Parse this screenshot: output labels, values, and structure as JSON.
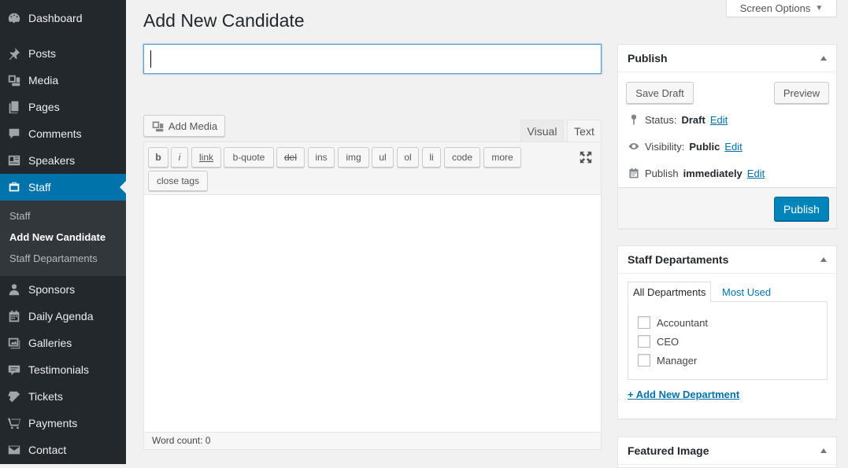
{
  "sidebar": {
    "items": [
      {
        "label": "Dashboard",
        "icon": "dashboard-icon"
      },
      {
        "label": "Posts",
        "icon": "pin-icon"
      },
      {
        "label": "Media",
        "icon": "media-icon"
      },
      {
        "label": "Pages",
        "icon": "pages-icon"
      },
      {
        "label": "Comments",
        "icon": "comment-icon"
      },
      {
        "label": "Speakers",
        "icon": "id-card-icon"
      },
      {
        "label": "Staff",
        "icon": "staff-icon"
      },
      {
        "label": "Sponsors",
        "icon": "user-icon"
      },
      {
        "label": "Daily Agenda",
        "icon": "calendar-icon"
      },
      {
        "label": "Galleries",
        "icon": "gallery-icon"
      },
      {
        "label": "Testimonials",
        "icon": "testimonial-icon"
      },
      {
        "label": "Tickets",
        "icon": "tickets-icon"
      },
      {
        "label": "Payments",
        "icon": "cart-icon"
      },
      {
        "label": "Contact",
        "icon": "mail-icon"
      }
    ],
    "submenu": [
      "Staff",
      "Add New Candidate",
      "Staff Departaments"
    ]
  },
  "header": {
    "screen_options": "Screen Options",
    "title": "Add New Candidate"
  },
  "editor": {
    "title_value": "",
    "add_media": "Add Media",
    "tab_visual": "Visual",
    "tab_text": "Text",
    "quicktags": [
      "b",
      "i",
      "link",
      "b-quote",
      "del",
      "ins",
      "img",
      "ul",
      "ol",
      "li",
      "code",
      "more",
      "close tags"
    ],
    "word_count": "Word count: 0"
  },
  "publish": {
    "title": "Publish",
    "save_draft": "Save Draft",
    "preview": "Preview",
    "status_label": "Status:",
    "status_value": "Draft",
    "visibility_label": "Visibility:",
    "visibility_value": "Public",
    "publish_label": "Publish",
    "publish_value": "immediately",
    "edit": "Edit",
    "publish_button": "Publish"
  },
  "departments": {
    "title": "Staff Departaments",
    "tab_all": "All Departments",
    "tab_most": "Most Used",
    "items": [
      "Accountant",
      "CEO",
      "Manager"
    ],
    "add_new": "+ Add New Department"
  },
  "featured": {
    "title": "Featured Image"
  },
  "colors": {
    "sidebar_bg": "#23282d",
    "active_bg": "#0073aa",
    "primary_button": "#0085ba"
  }
}
